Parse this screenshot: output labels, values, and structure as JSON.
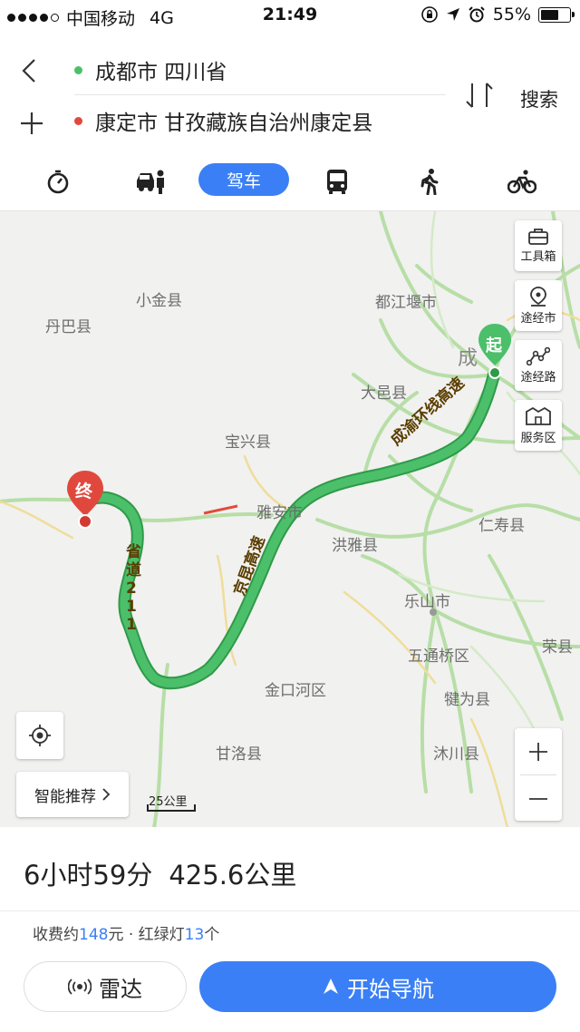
{
  "status_bar": {
    "carrier": "中国移动",
    "network": "4G",
    "time": "21:49",
    "battery": "55%"
  },
  "route": {
    "origin": "成都市 四川省",
    "destination": "康定市 甘孜藏族自治州康定县",
    "search_label": "搜索",
    "origin_dot_color": "#4cbf6b",
    "destination_dot_color": "#e0483e"
  },
  "modes": {
    "active_label": "驾车",
    "items": [
      "stopwatch-icon",
      "taxi-icon",
      "car-icon",
      "bus-icon",
      "walk-icon",
      "bike-icon"
    ]
  },
  "map": {
    "places": [
      "小金县",
      "丹巴县",
      "都江堰市",
      "成",
      "大邑县",
      "宝兴县",
      "雅安市",
      "洪雅县",
      "仁寿县",
      "乐山市",
      "五通桥区",
      "荣县",
      "金口河区",
      "犍为县",
      "甘洛县",
      "沐川县"
    ],
    "road_labels": {
      "chengyu": "成渝环线高速",
      "jingkun": "京昆高速",
      "s211": "省道211"
    },
    "start_marker": "起",
    "end_marker": "终",
    "tools": [
      "工具箱",
      "途经市",
      "途经路",
      "服务区"
    ],
    "recommend": "智能推荐",
    "scale": "25公里",
    "route_color": "#4cbf6b"
  },
  "summary": {
    "duration": "6小时59分",
    "distance": "425.6公里",
    "toll_prefix": "收费约",
    "toll_value": "148",
    "toll_unit": "元 · 红绿灯",
    "lights_value": "13",
    "lights_unit": "个"
  },
  "buttons": {
    "radar": "雷达",
    "start_nav": "开始导航"
  }
}
